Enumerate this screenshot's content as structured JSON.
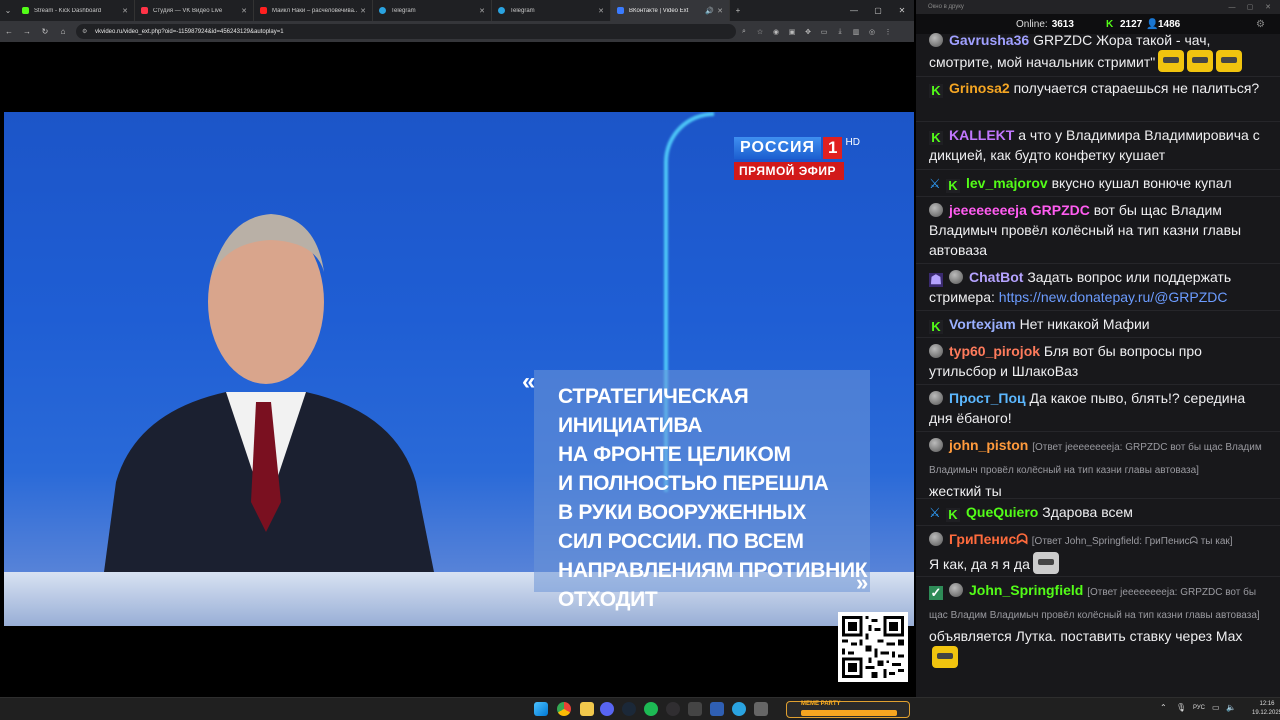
{
  "browser": {
    "tabs": [
      {
        "title": "Stream - Kick Dashboard",
        "fav": "#53fc18",
        "active": false
      },
      {
        "title": "Студия — VK Видео Live",
        "fav": "#ff3347",
        "active": false
      },
      {
        "title": "Майкл Наки – расчеловечива...",
        "fav": "#ff2020",
        "active": false
      },
      {
        "title": "Telegram",
        "fav": "#2aa3e0",
        "active": false
      },
      {
        "title": "Telegram",
        "fav": "#2aa3e0",
        "active": false
      },
      {
        "title": "ВКонтакте | Video Ext",
        "fav": "#3a7bff",
        "active": true
      }
    ],
    "new_tab": "+",
    "url": "vkvideo.ru/video_ext.php?oid=-115987924&id=456243129&autoplay=1"
  },
  "video": {
    "channel_logo": "РОССИЯ",
    "channel_number": "1",
    "hd": "HD",
    "live_badge": "ПРЯМОЙ ЭФИР",
    "caption_lines": [
      "СТРАТЕГИЧЕСКАЯ ИНИЦИАТИВА",
      "НА ФРОНТЕ ЦЕЛИКОМ",
      "И ПОЛНОСТЬЮ ПЕРЕШЛА",
      "В РУКИ ВООРУЖЕННЫХ",
      "СИЛ РОССИИ. ПО ВСЕМ",
      "НАПРАВЛЕНИЯМ ПРОТИВНИК",
      "ОТХОДИТ"
    ]
  },
  "chat": {
    "window_title": "Окно в друку",
    "online_label": "Online:",
    "online_count": "3613",
    "kick_count": "2127",
    "vk_count": "1486",
    "messages": [
      {
        "name": "Gavrusha36",
        "color": "#a0a0ff",
        "text": "GRPZDC Жора такой - чач, смотрите, мой начальник стримит\"",
        "mention": ""
      },
      {
        "name": "Grinosa2",
        "color": "#f5a623",
        "text": "получается стараешься не палиться?"
      },
      {
        "name": "KALLEKT",
        "color": "#c277ff",
        "text": "а что у Владимира Владимировича с дикцией, как будто конфетку кушает"
      },
      {
        "name": "lev_majorov",
        "color": "#53fc18",
        "text": "вкусно кушал вонюче купал"
      },
      {
        "name": "jeeeeeeeeja",
        "color": "#ff5cf0",
        "mention": "GRPZDC",
        "text": "вот бы щас Владим Владимыч провёл колёсный на тип казни главы автоваза"
      },
      {
        "name": "ChatBot",
        "color": "#b5a3ff",
        "text": "Задать вопрос или поддержать стримера:",
        "link": "https://new.donatepay.ru/@GRPZDC"
      },
      {
        "name": "Vortexjam",
        "color": "#9ab0ff",
        "text": "Нет никакой Мафии"
      },
      {
        "name": "typ60_pirojok",
        "color": "#ff7b5c",
        "text": "Бля вот бы вопросы про утильсбор и ШлакоВаз"
      },
      {
        "name": "Прост_Поц",
        "color": "#5cb8ff",
        "text": "Да какое пыво, блять!? середина дня ёбаного!"
      },
      {
        "name": "john_piston",
        "color": "#ff9a3c",
        "reply": "[Ответ jeeeeeeeeja: GRPZDC вот бы щас Владим Владимыч провёл колёсный на тип казни главы автоваза]",
        "text": "жесткий ты"
      },
      {
        "name": "QueQuiero",
        "color": "#53fc18",
        "text": "Здарова всем"
      },
      {
        "name": "ГриПенисᗣ",
        "color": "#ff6b3d",
        "reply": "[Ответ John_Springfield: ГриПенисᗣ ты как]",
        "text": "Я как, да я я да"
      },
      {
        "name": "John_Springfield",
        "color": "#53fc18",
        "reply": "[Ответ jeeeeeeeeja: GRPZDC вот бы щас Владим Владимыч провёл колёсный на тип казни главы автоваза]",
        "text": "объявляется Лутка. поставить ставку через Max"
      }
    ]
  },
  "taskbar": {
    "lang": "РУС",
    "time": "12:16",
    "date": "19.12.2025",
    "meme_label": "MEME PARTY"
  },
  "colors": {
    "accent": "#53fc18",
    "chat_bg": "#18181b",
    "video_bg": "#1f5ed4"
  }
}
